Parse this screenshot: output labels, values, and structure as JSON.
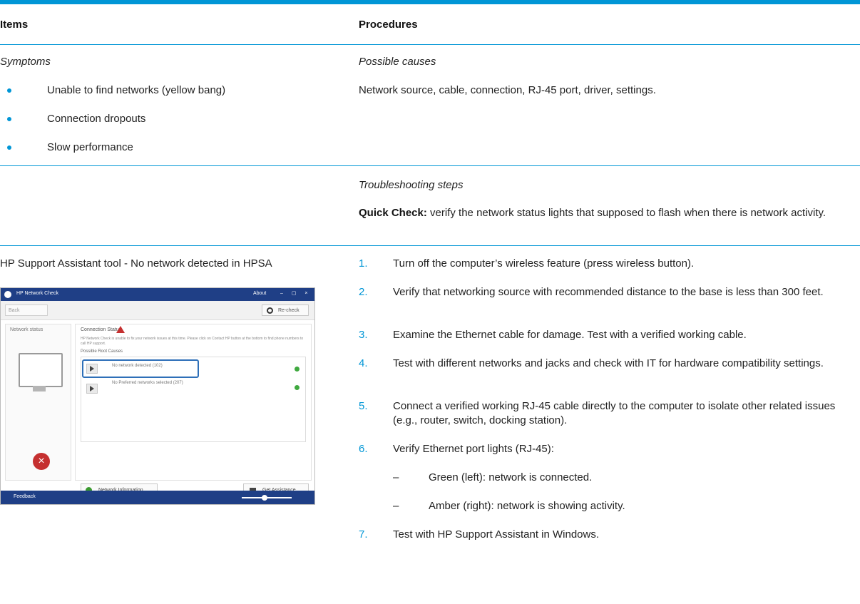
{
  "headers": {
    "items": "Items",
    "procedures": "Procedures"
  },
  "section1": {
    "symptoms_label": "Symptoms",
    "symptoms": [
      "Unable to find networks (yellow bang)",
      "Connection dropouts",
      "Slow performance"
    ],
    "causes_label": "Possible causes",
    "causes_text": "Network source, cable, connection, RJ-45 port, driver, settings."
  },
  "section2": {
    "troubleshooting_label": "Troubleshooting steps",
    "quick_check_label": "Quick Check:",
    "quick_check_text": "verify the network status lights that supposed to flash when there is network activity."
  },
  "section3": {
    "item_text": "HP Support Assistant tool - No network detected in HPSA",
    "steps": [
      {
        "num": "1.",
        "text": "Turn off the computer’s wireless feature (press wireless button)."
      },
      {
        "num": "2.",
        "text": "Verify that networking source with recommended distance to the base is less than 300 feet."
      },
      {
        "num": "3.",
        "text": "Examine the Ethernet cable for damage. Test with a verified working cable."
      },
      {
        "num": "4.",
        "text": "Test with different networks and jacks and check with IT for hardware compatibility settings."
      },
      {
        "num": "5.",
        "text": "Connect a verified working RJ-45 cable directly to the computer to isolate other related issues (e.g., router, switch, docking station)."
      },
      {
        "num": "6.",
        "text": "Verify Ethernet port lights (RJ-45):"
      },
      {
        "num": "7.",
        "text": "Test with HP Support Assistant in Windows."
      }
    ],
    "sub_items": [
      {
        "dash": "–",
        "text": "Green (left): network is connected."
      },
      {
        "dash": "–",
        "text": "Amber (right): network is showing activity."
      }
    ]
  },
  "screenshot": {
    "title": "HP Network Check",
    "about": "About",
    "window_controls": "– ▢ ×",
    "back": "Back",
    "recheck": "Re-check",
    "network_status": "Network status",
    "connection_status": "Connection Status",
    "description": "HP Network Check is unable to fix your network issues at this time. Please click on Contact HP button at the bottom to find phone numbers to call HP support.",
    "possible_root_causes": "Possible Root Causes",
    "row1": "No network detected (102)",
    "row2": "No Preferred networks selected (207)",
    "network_information": "Network Information",
    "get_assistance": "Get Assistance",
    "feedback": "Feedback"
  },
  "colors": {
    "accent": "#0096d6",
    "hp_blue": "#1f3f86"
  }
}
